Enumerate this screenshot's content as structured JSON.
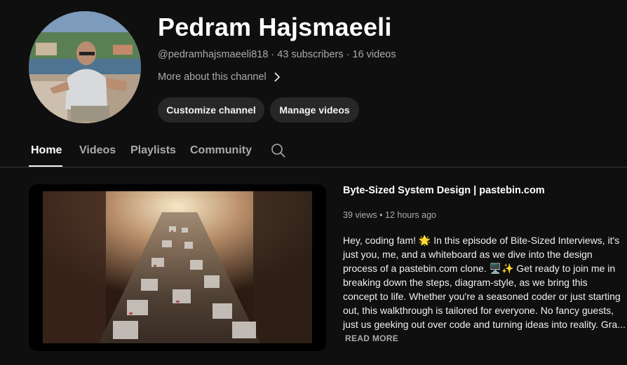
{
  "channel": {
    "name": "Pedram Hajsmaeeli",
    "handle": "@pedramhajsmaeeli818",
    "subscribers": "43 subscribers",
    "videos": "16 videos",
    "separator": "·",
    "about_link": "More about this channel"
  },
  "actions": {
    "customize_label": "Customize channel",
    "manage_label": "Manage videos"
  },
  "tabs": [
    {
      "label": "Home",
      "active": true
    },
    {
      "label": "Videos",
      "active": false
    },
    {
      "label": "Playlists",
      "active": false
    },
    {
      "label": "Community",
      "active": false
    }
  ],
  "featured_video": {
    "title": "Byte-Sized System Design | pastebin.com",
    "views": "39 views",
    "age": "12 hours ago",
    "stats_separator": "•",
    "description_lines": [
      "Hey, coding fam! 🌟 In this episode of Bite-Sized Interviews, it's",
      "just you, me, and a whiteboard as we dive into the design",
      "process of a pastebin.com clone. 🖥️✨ Get ready to join me in",
      "breaking down the steps, diagram-style, as we bring this",
      "concept to life. Whether you're a seasoned coder or just starting",
      "out, this walkthrough is tailored for everyone. No fancy guests,",
      "just us geeking out over code and turning ideas into reality. Gra..."
    ],
    "read_more": "READ MORE"
  },
  "icons": {
    "about": "chevron-right-icon",
    "tab_search": "search-icon"
  },
  "colors": {
    "background": "#0f0f0f",
    "button_bg": "#272727",
    "secondary_text": "#aaaaaa",
    "primary_text": "#f1f1f1"
  }
}
